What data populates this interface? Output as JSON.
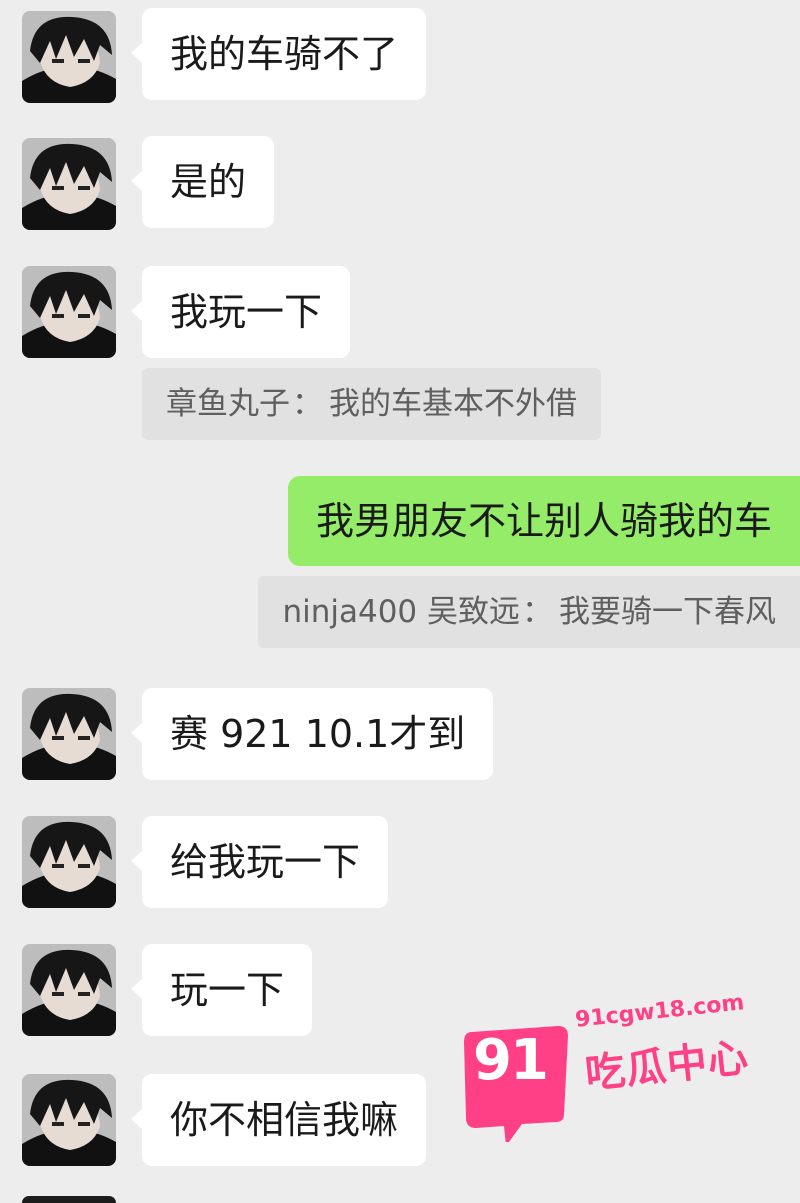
{
  "messages": [
    {
      "type": "text",
      "side": "left",
      "text": "我的车骑不了"
    },
    {
      "type": "text",
      "side": "left",
      "text": "是的"
    },
    {
      "type": "text",
      "side": "left",
      "text": "我玩一下"
    },
    {
      "type": "quote",
      "sender": "章鱼丸子",
      "text": "我的车基本不外借"
    },
    {
      "type": "text",
      "side": "right",
      "text": "我男朋友不让别人骑我的车"
    },
    {
      "type": "quote",
      "sender": "ninja400 吴致远",
      "text": "我要骑一下春风"
    },
    {
      "type": "text",
      "side": "left",
      "text": "赛 921 10.1才到"
    },
    {
      "type": "text",
      "side": "left",
      "text": "给我玩一下"
    },
    {
      "type": "text",
      "side": "left",
      "text": "玩一下"
    },
    {
      "type": "text",
      "side": "left",
      "text": "你不相信我嘛"
    }
  ],
  "quote_separator": "：",
  "watermark": {
    "logo_number": "91",
    "domain": "91cgw18.com",
    "name": "吃瓜中心"
  },
  "colors": {
    "background": "#ededed",
    "incoming_bubble": "#ffffff",
    "outgoing_bubble": "#95ec69",
    "quote_background": "#e1e1e1",
    "quote_text": "#5f5f5f",
    "watermark_pink": "#ff3f86"
  },
  "icons": {
    "avatar": "anime-boy-avatar-icon",
    "watermark_logo": "speech-bubble-logo-icon"
  }
}
